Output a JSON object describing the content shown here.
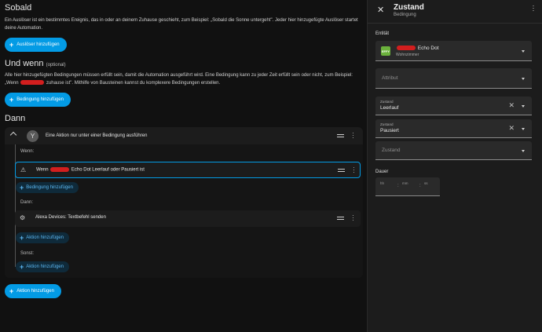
{
  "trigger": {
    "title": "Sobald",
    "description": "Ein Auslöser ist ein bestimmtes Ereignis, das in oder an deinem Zuhause geschieht, zum Beispiel: „Sobald die Sonne untergeht\". Jeder hier hinzugefügte Auslöser startet deine Automation.",
    "add_label": "Auslöser hinzufügen"
  },
  "conditions": {
    "title": "Und wenn",
    "optional": "(optional)",
    "description_a": "Alle hier hinzugefügten Bedingungen müssen erfüllt sein, damit die Automation ausgeführt wird. Eine Bedingung kann zu jeder Zeit erfüllt sein oder nicht, zum Beispiel: „Wenn",
    "description_b": "zuhause ist\". Mithilfe von Bausteinen kannst du komplexere Bedingungen erstellen.",
    "add_label": "Bedingung hinzufügen"
  },
  "actions": {
    "title": "Dann",
    "add_label": "Aktion hinzufügen",
    "choose": {
      "title": "Eine Aktion nur unter einer Bedingung ausführen",
      "if_label": "Wenn:",
      "condition_prefix": "Wenn",
      "condition_suffix": "Echo Dot Leerlauf oder Pausiert ist",
      "add_condition_label": "Bedingung hinzufügen",
      "then_label": "Dann:",
      "action_text": "Alexa Devices: Textbefehl senden",
      "add_action_label": "Aktion hinzufügen",
      "else_label": "Sonst:",
      "add_else_action_label": "Aktion hinzufügen"
    }
  },
  "panel": {
    "title": "Zustand",
    "subtitle": "Bedingung",
    "entity_label": "Entität",
    "entity_icon_text": "EFFY",
    "entity_name": "Echo Dot",
    "entity_area": "Wohnzimmer",
    "attribute_placeholder": "Attribut",
    "state1_label": "Zustand",
    "state1_value": "Leerlauf",
    "state2_label": "Zustand",
    "state2_value": "Pausiert",
    "state3_placeholder": "Zustand",
    "duration_label": "Dauer",
    "duration_hh": "hh",
    "duration_mm": "mm",
    "duration_ss": "ss"
  },
  "colors": {
    "accent": "#039be5",
    "background": "#111111",
    "card": "#1c1c1c",
    "redaction": "#d21e1e"
  },
  "icons": [
    "plus-icon",
    "chevron-up-icon",
    "choose-icon",
    "drag-handle-icon",
    "more-vert-icon",
    "condition-state-icon",
    "service-action-icon",
    "close-icon",
    "dropdown-arrow-icon",
    "clear-icon"
  ]
}
